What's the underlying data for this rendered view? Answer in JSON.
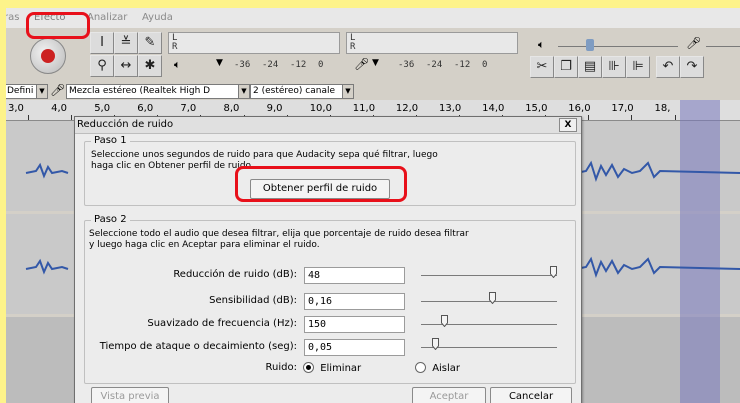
{
  "menu": {
    "items": [
      "ras",
      "Efecto",
      "Analizar",
      "Ayuda"
    ]
  },
  "toolbar": {
    "meter_ticks_play": [
      "-36",
      "-24",
      "-12",
      "0"
    ],
    "meter_ticks_rec": [
      "-36",
      "-24",
      "-12",
      "0"
    ],
    "meter_l": "L",
    "meter_r": "R"
  },
  "devices": {
    "host": "Defini",
    "input": "Mezcla estéreo (Realtek High D",
    "channels": "2 (estéreo) canale"
  },
  "ruler": {
    "ticks": [
      "3,0",
      "4,0",
      "5,0",
      "6,0",
      "7,0",
      "8,0",
      "9,0",
      "10,0",
      "11,0",
      "12,0",
      "13,0",
      "14,0",
      "15,0",
      "16,0",
      "17,0",
      "18,"
    ]
  },
  "dialog": {
    "title": "Reducción de ruido",
    "close": "X",
    "step1": {
      "title": "Paso 1",
      "text_line1": "Seleccione unos segundos de ruido para que Audacity sepa qué filtrar, luego",
      "text_line2": "haga clic en Obtener perfil de ruido.",
      "button": "Obtener perfil de ruido"
    },
    "step2": {
      "title": "Paso 2",
      "text_line1": "Seleccione todo el audio que desea filtrar, elija que porcentaje de ruido desea filtrar",
      "text_line2": "y luego haga clic en Aceptar para eliminar el ruido.",
      "fields": [
        {
          "label": "Reducción de ruido (dB):",
          "value": "48",
          "slider": 0.97
        },
        {
          "label": "Sensibilidad (dB):",
          "value": "0,16",
          "slider": 0.52
        },
        {
          "label": "Suavizado de frecuencia (Hz):",
          "value": "150",
          "slider": 0.17
        },
        {
          "label": "Tiempo de ataque o decaimiento (seg):",
          "value": "0,05",
          "slider": 0.1
        }
      ],
      "noise_label": "Ruido:",
      "radio_remove": "Eliminar",
      "radio_isolate": "Aislar"
    },
    "preview": "Vista previa",
    "ok": "Aceptar",
    "cancel": "Cancelar"
  }
}
